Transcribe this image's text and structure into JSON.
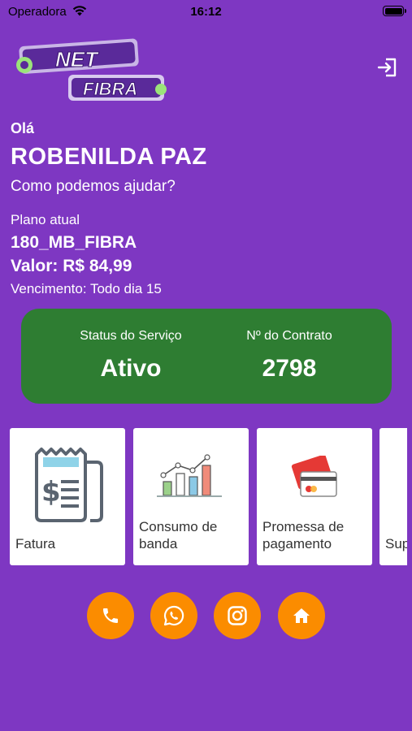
{
  "status_bar": {
    "carrier": "Operadora",
    "time": "16:12"
  },
  "logo": {
    "line1": "NET",
    "line2": "FIBRA"
  },
  "greeting": "Olá",
  "user": {
    "name": "ROBENILDA PAZ"
  },
  "help_text": "Como podemos ajudar?",
  "plan": {
    "label": "Plano atual",
    "name": "180_MB_FIBRA",
    "value": "Valor: R$ 84,99",
    "due": "Vencimento: Todo dia 15"
  },
  "service_card": {
    "status_label": "Status do Serviço",
    "status_value": "Ativo",
    "contract_label": "Nº do Contrato",
    "contract_value": "2798",
    "color": "#2e7d32"
  },
  "tiles": [
    {
      "label_line1": "Fatura",
      "label_line2": "",
      "icon": "invoice-icon"
    },
    {
      "label_line1": "Consumo de",
      "label_line2": "banda",
      "icon": "bar-chart-icon"
    },
    {
      "label_line1": "Promessa de",
      "label_line2": "pagamento",
      "icon": "credit-card-icon"
    },
    {
      "label_line1": "Sup",
      "label_line2": "",
      "icon": "support-icon"
    }
  ],
  "fabs": [
    {
      "icon": "phone-icon"
    },
    {
      "icon": "whatsapp-icon"
    },
    {
      "icon": "instagram-icon"
    },
    {
      "icon": "home-icon"
    }
  ],
  "colors": {
    "background": "#7e37c2",
    "accent": "#fb8c00",
    "tile": "#ffffff"
  }
}
